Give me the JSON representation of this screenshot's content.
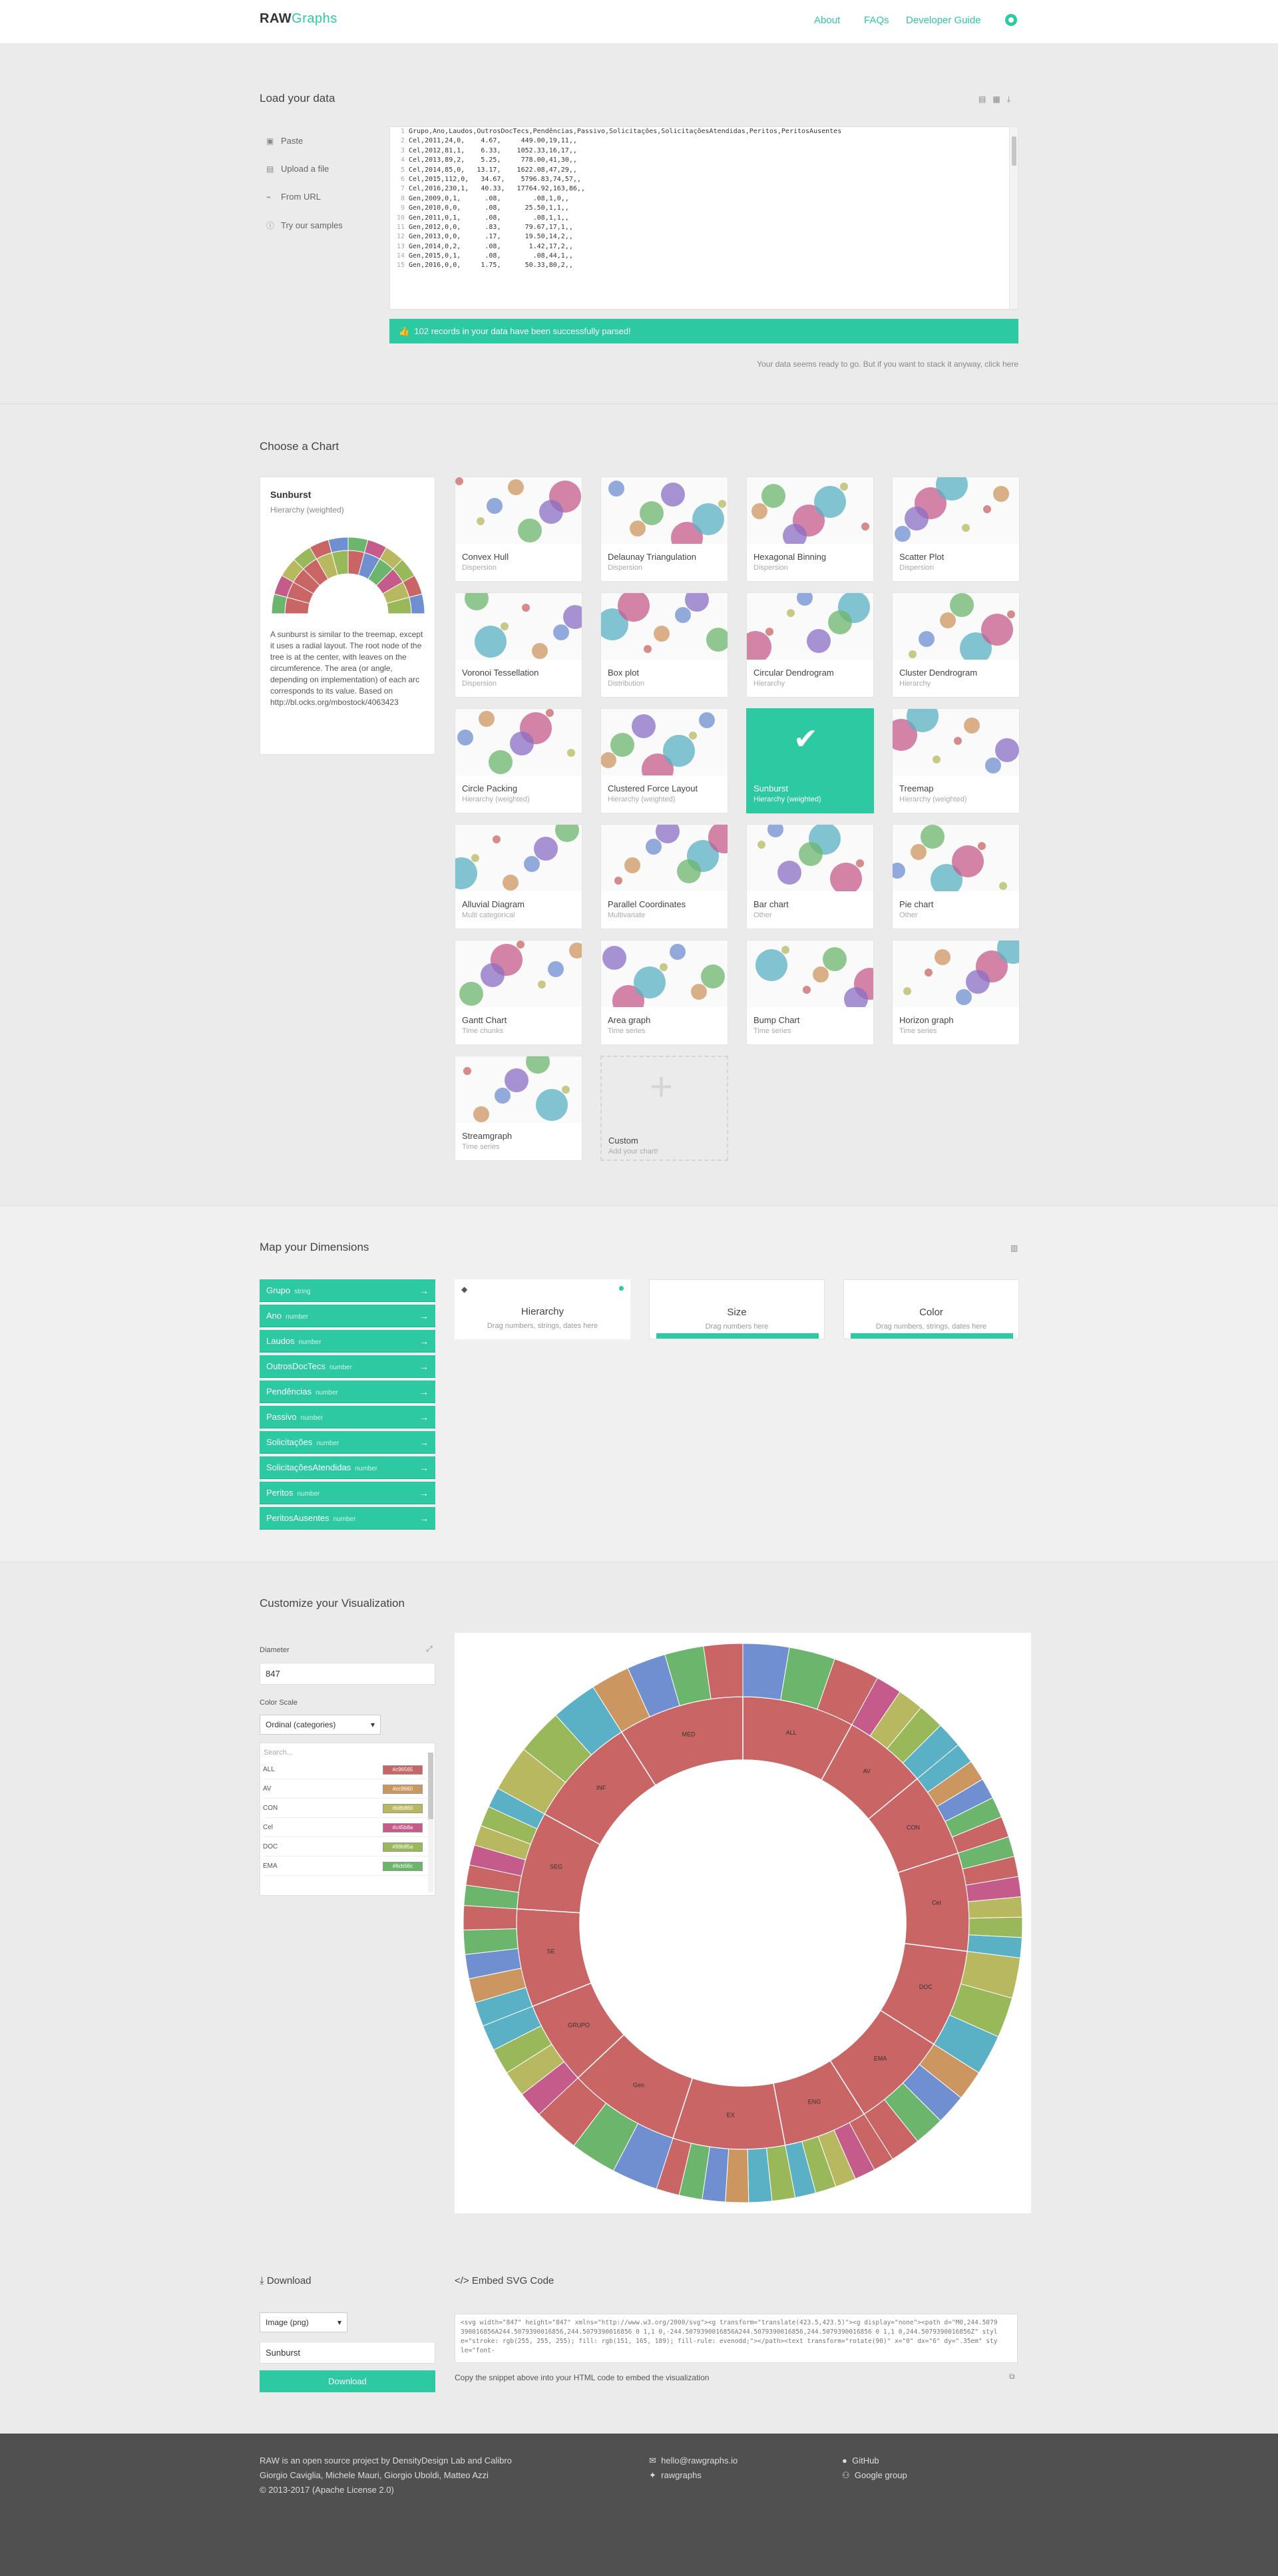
{
  "header": {
    "logo_bold": "RAW",
    "logo_light": "Graphs",
    "nav": [
      "About",
      "FAQs",
      "Developer Guide"
    ]
  },
  "load": {
    "title": "Load your data",
    "options": [
      {
        "icon": "paste-icon",
        "label": "Paste"
      },
      {
        "icon": "upload-icon",
        "label": "Upload a file"
      },
      {
        "icon": "link-icon",
        "label": "From URL"
      },
      {
        "icon": "info-icon",
        "label": "Try our samples"
      }
    ],
    "lines": [
      "Grupo,Ano,Laudos,OutrosDocTecs,Pendências,Passivo,Solicitações,SolicitaçõesAtendidas,Peritos,PeritosAusentes",
      "Cel,2011,24,0,    4.67,     449.00,19,11,,",
      "Cel,2012,81,1,    6.33,    1052.33,16,17,,",
      "Cel,2013,89,2,    5.25,     778.00,41,30,,",
      "Cel,2014,85,0,   13.17,    1622.08,47,29,,",
      "Cel,2015,112,0,   34.67,    5796.83,74,57,,",
      "Cel,2016,230,1,   40.33,   17764.92,163,86,,",
      "Gen,2009,0,1,      .08,        .08,1,0,,",
      "Gen,2010,0,0,      .08,      25.50,1,1,,",
      "Gen,2011,0,1,      .08,        .08,1,1,,",
      "Gen,2012,0,0,      .83,      79.67,17,1,,",
      "Gen,2013,0,0,      .17,      19.50,14,2,,",
      "Gen,2014,0,2,      .08,       1.42,17,2,,",
      "Gen,2015,0,1,      .08,        .08,44,1,,",
      "Gen,2016,0,0,     1.75,      50.33,80,2,,"
    ],
    "success": "102 records in your data have been successfully parsed!",
    "note": "Your data seems ready to go. But if you want to stack it anyway, click here"
  },
  "choose": {
    "title": "Choose a Chart",
    "selected": {
      "name": "Sunburst",
      "type": "Hierarchy (weighted)",
      "desc": "A sunburst is similar to the treemap, except it uses a radial layout. The root node of the tree is at the center, with leaves on the circumference. The area (or angle, depending on implementation) of each arc corresponds to its value. Based on http://bl.ocks.org/mbostock/4063423"
    },
    "charts": [
      {
        "name": "Convex Hull",
        "type": "Dispersion"
      },
      {
        "name": "Delaunay Triangulation",
        "type": "Dispersion"
      },
      {
        "name": "Hexagonal Binning",
        "type": "Dispersion"
      },
      {
        "name": "Scatter Plot",
        "type": "Dispersion"
      },
      {
        "name": "Voronoi Tessellation",
        "type": "Dispersion"
      },
      {
        "name": "Box plot",
        "type": "Distribution"
      },
      {
        "name": "Circular Dendrogram",
        "type": "Hierarchy"
      },
      {
        "name": "Cluster Dendrogram",
        "type": "Hierarchy"
      },
      {
        "name": "Circle Packing",
        "type": "Hierarchy (weighted)"
      },
      {
        "name": "Clustered Force Layout",
        "type": "Hierarchy (weighted)"
      },
      {
        "name": "Sunburst",
        "type": "Hierarchy (weighted)"
      },
      {
        "name": "Treemap",
        "type": "Hierarchy (weighted)"
      },
      {
        "name": "Alluvial Diagram",
        "type": "Multi categorical"
      },
      {
        "name": "Parallel Coordinates",
        "type": "Multivariate"
      },
      {
        "name": "Bar chart",
        "type": "Other"
      },
      {
        "name": "Pie chart",
        "type": "Other"
      },
      {
        "name": "Gantt Chart",
        "type": "Time chunks"
      },
      {
        "name": "Area graph",
        "type": "Time series"
      },
      {
        "name": "Bump Chart",
        "type": "Time series"
      },
      {
        "name": "Horizon graph",
        "type": "Time series"
      },
      {
        "name": "Streamgraph",
        "type": "Time series"
      },
      {
        "name": "Custom",
        "type": "Add your chart!"
      }
    ]
  },
  "map": {
    "title": "Map your Dimensions",
    "dims": [
      {
        "name": "Grupo",
        "type": "string"
      },
      {
        "name": "Ano",
        "type": "number"
      },
      {
        "name": "Laudos",
        "type": "number"
      },
      {
        "name": "OutrosDocTecs",
        "type": "number"
      },
      {
        "name": "Pendências",
        "type": "number"
      },
      {
        "name": "Passivo",
        "type": "number"
      },
      {
        "name": "Solicitações",
        "type": "number"
      },
      {
        "name": "SolicitaçõesAtendidas",
        "type": "number"
      },
      {
        "name": "Peritos",
        "type": "number"
      },
      {
        "name": "PeritosAusentes",
        "type": "number"
      }
    ],
    "slots": [
      {
        "title": "Hierarchy",
        "hint": "Drag numbers, strings, dates here"
      },
      {
        "title": "Size",
        "hint": "Drag numbers here"
      },
      {
        "title": "Color",
        "hint": "Drag numbers, strings, dates here"
      }
    ]
  },
  "custom": {
    "title": "Customize your Visualization",
    "diameter_label": "Diameter",
    "diameter": "847",
    "scale_label": "Color Scale",
    "scale": "Ordinal (categories)",
    "search": "Search...",
    "colors": [
      {
        "name": "ALL",
        "hex": "#c96565"
      },
      {
        "name": "AV",
        "hex": "#cc9660"
      },
      {
        "name": "CON",
        "hex": "#b8b860"
      },
      {
        "name": "Cel",
        "hex": "#c45b8a"
      },
      {
        "name": "DOC",
        "hex": "#99b85a"
      },
      {
        "name": "EMA",
        "hex": "#6cb56c"
      }
    ]
  },
  "download": {
    "title": "Download",
    "format": "Image (png)",
    "filename": "Sunburst",
    "button": "Download"
  },
  "embed": {
    "title": "Embed SVG Code",
    "code": "<svg width=\"847\" height=\"847\" xmlns=\"http://www.w3.org/2000/svg\"><g transform=\"translate(423.5,423.5)\"><g display=\"none\"><path d=\"M0,244.5079390016856A244.5079390016856,244.5079390016856 0 1,1 0,-244.5079390016856A244.5079390016856,244.5079390016856 0 1,1 0,244.5079390016856Z\" style=\"stroke: rgb(255, 255, 255); fill: rgb(151, 165, 189); fill-rule: evenodd;\"></path><text transform=\"rotate(90)\" x=\"0\" dx=\"6\" dy=\".35em\" style=\"font-",
    "hint": "Copy the snippet above into your HTML code to embed the visualization"
  },
  "footer": {
    "about": "RAW is an open source project by DensityDesign Lab and Calibro",
    "authors": "Giorgio Caviglia, Michele Mauri, Giorgio Uboldi, Matteo Azzi",
    "license": "© 2013-2017 (Apache License 2.0)",
    "email": "hello@rawgraphs.io",
    "twitter": "rawgraphs",
    "github": "GitHub",
    "group": "Google group"
  },
  "sunburst_data": {
    "inner_segments": [
      {
        "label": "ALL",
        "value": 8
      },
      {
        "label": "AV",
        "value": 6
      },
      {
        "label": "CON",
        "value": 6
      },
      {
        "label": "Cel",
        "value": 7
      },
      {
        "label": "DOC",
        "value": 7
      },
      {
        "label": "EMA",
        "value": 7
      },
      {
        "label": "ENG",
        "value": 6
      },
      {
        "label": "EX",
        "value": 8
      },
      {
        "label": "Gen",
        "value": 8
      },
      {
        "label": "GRUPO",
        "value": 6
      },
      {
        "label": "SE",
        "value": 7
      },
      {
        "label": "SEG",
        "value": 7
      },
      {
        "label": "INF",
        "value": 8
      },
      {
        "label": "MED",
        "value": 9
      }
    ]
  }
}
